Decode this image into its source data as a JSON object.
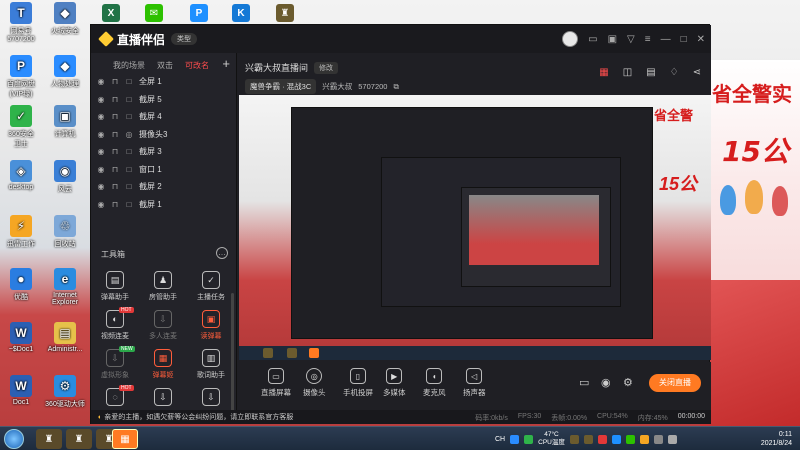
{
  "desktop": {
    "banner_text_1": "省全警实",
    "banner_text_2": "15公",
    "icons": [
      {
        "label": "网易号\n5707200",
        "color": "#3b7dd8",
        "glyph": "T"
      },
      {
        "label": "百度网盘\n(VIP绿)",
        "color": "#2a8cff",
        "glyph": "P"
      },
      {
        "label": "360安全\n卫士",
        "color": "#2fb34a",
        "glyph": "✓"
      },
      {
        "label": "desktop",
        "color": "#4a90d9",
        "glyph": "◈"
      },
      {
        "label": "迅雷工作",
        "color": "#f5a623",
        "glyph": "⚡"
      },
      {
        "label": "优酷",
        "color": "#2a7de1",
        "glyph": "●"
      },
      {
        "label": "~$Doc1",
        "color": "#2b5fb3",
        "glyph": "W"
      },
      {
        "label": "Doc1",
        "color": "#2b5fb3",
        "glyph": "W"
      }
    ],
    "icons_col2": [
      {
        "label": "火绒安全",
        "color": "#4f80c2",
        "glyph": "◆"
      },
      {
        "label": "人物处理",
        "color": "#2a8cff",
        "glyph": "◆"
      },
      {
        "label": "计算机",
        "color": "#5a8fc8",
        "glyph": "▣"
      },
      {
        "label": "风云",
        "color": "#3a7fd6",
        "glyph": "◉"
      },
      {
        "label": "回收站",
        "color": "#7da8d8",
        "glyph": "♲"
      },
      {
        "label": "Internet\nExplorer",
        "color": "#2a8ce0",
        "glyph": "e"
      },
      {
        "label": "Administr...",
        "color": "#e6c14a",
        "glyph": "▤"
      },
      {
        "label": "360驱动大师",
        "color": "#2a8ce0",
        "glyph": "⚙"
      }
    ],
    "top_icons": [
      {
        "color": "#217346",
        "glyph": "X"
      },
      {
        "color": "#2dc100",
        "glyph": "✉"
      },
      {
        "color": "#1e90ff",
        "glyph": "P"
      },
      {
        "color": "#1479d6",
        "glyph": "K"
      },
      {
        "color": "#6b5b2e",
        "glyph": "♜"
      }
    ]
  },
  "app": {
    "name": "直播伴侣",
    "type_badge": "类型",
    "avatar_icon": "avatar",
    "tabs": {
      "my_scene": "我的场景",
      "double": "双击",
      "editable": "可改名"
    },
    "add_scene": "+",
    "scenes": [
      {
        "label": "全屏 1",
        "type": "□"
      },
      {
        "label": "截屏 5",
        "type": "□"
      },
      {
        "label": "截屏 4",
        "type": "□"
      },
      {
        "label": "摄像头3",
        "type": "◎"
      },
      {
        "label": "截屏 3",
        "type": "□"
      },
      {
        "label": "窗口 1",
        "type": "□"
      },
      {
        "label": "截屏 2",
        "type": "□"
      },
      {
        "label": "截屏 1",
        "type": "□"
      }
    ],
    "tools_heading": "工具箱",
    "tools": [
      {
        "label": "弹幕助手",
        "glyph": "▤",
        "state": "normal",
        "tag": ""
      },
      {
        "label": "房管助手",
        "glyph": "♟",
        "state": "normal",
        "tag": ""
      },
      {
        "label": "主播任务",
        "glyph": "✓",
        "state": "normal",
        "tag": ""
      },
      {
        "label": "视频连麦",
        "glyph": "◐",
        "state": "normal",
        "tag": "HOT"
      },
      {
        "label": "多人连麦",
        "glyph": "⇩",
        "state": "dim",
        "tag": ""
      },
      {
        "label": "读弹幕",
        "glyph": "▣",
        "state": "hot",
        "tag": ""
      },
      {
        "label": "虚拟形象",
        "glyph": "⇩",
        "state": "dim",
        "tag": "NEW"
      },
      {
        "label": "弹幕姬",
        "glyph": "▦",
        "state": "hot",
        "tag": ""
      },
      {
        "label": "歌词助手",
        "glyph": "▥",
        "state": "normal",
        "tag": ""
      },
      {
        "label": "",
        "glyph": "◌",
        "state": "normal",
        "tag": "HOT"
      },
      {
        "label": "",
        "glyph": "⇩",
        "state": "normal",
        "tag": ""
      },
      {
        "label": "",
        "glyph": "⇩",
        "state": "normal",
        "tag": ""
      }
    ],
    "room": {
      "title": "兴霸大叔直播间",
      "edit_label": "修改",
      "game": "魔兽争霸 · 混战3C",
      "host": "兴霸大叔",
      "id": "5707200"
    },
    "controls": [
      {
        "label": "直播屏幕",
        "glyph": "▭"
      },
      {
        "label": "摄像头",
        "glyph": "◎"
      },
      {
        "label": "手机投屏",
        "glyph": "▯"
      },
      {
        "label": "多媒体",
        "glyph": "▶"
      },
      {
        "label": "麦克风",
        "glyph": "◖"
      },
      {
        "label": "扬声器",
        "glyph": "◁"
      }
    ],
    "go_live": "关闭直播",
    "notice_prefix": "亲爱的主播，",
    "notice_text": "如遇欠薪等公会纠纷问题，请立即联系官方客服",
    "stats": {
      "dropped": "码率:0kb/s",
      "fps": "FPS:30",
      "drop_rate": "丢帧:0.00%",
      "cpu": "CPU:54%",
      "mem": "内存:45%",
      "duration": "00:00:00"
    },
    "preview_banner_1": "省全警",
    "preview_banner_2": "15公"
  },
  "taskbar": {
    "tray_temp": "47°C",
    "tray_label": "CPU温度",
    "ime": "CH",
    "time": "0:11",
    "date": "2021/8/24"
  }
}
